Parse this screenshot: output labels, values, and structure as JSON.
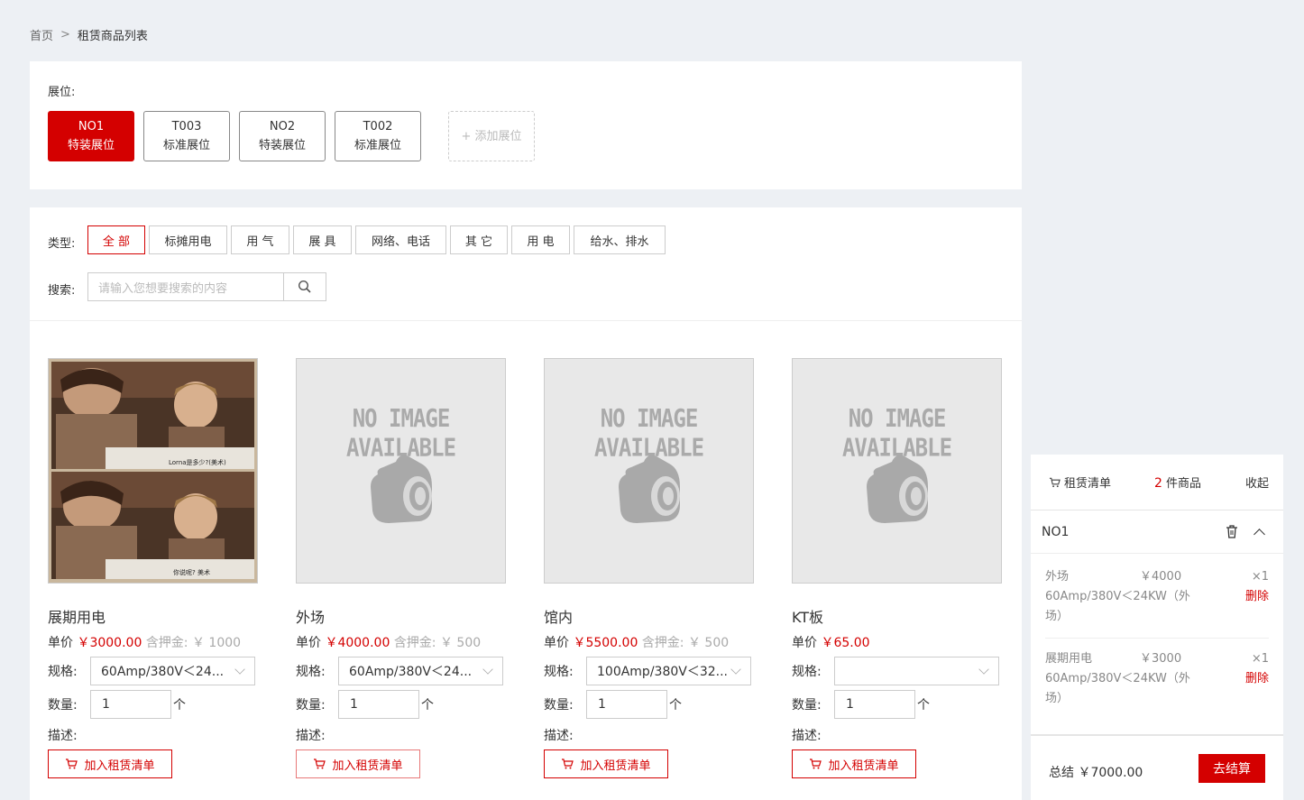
{
  "breadcrumb": {
    "home": "首页",
    "sep": ">",
    "current": "租赁商品列表"
  },
  "booths": {
    "label": "展位:",
    "items": [
      {
        "code": "NO1",
        "type": "特装展位"
      },
      {
        "code": "T003",
        "type": "标准展位"
      },
      {
        "code": "NO2",
        "type": "特装展位"
      },
      {
        "code": "T002",
        "type": "标准展位"
      }
    ],
    "add_label": "+ 添加展位"
  },
  "filters": {
    "type_label": "类型:",
    "types": [
      "全 部",
      "标摊用电",
      "用 气",
      "展 具",
      "网络、电话",
      "其 它",
      "用 电",
      "给水、排水"
    ],
    "search_label": "搜索:",
    "search_placeholder": "请输入您想要搜索的内容"
  },
  "products": [
    {
      "name": "展期用电",
      "price_label": "单价",
      "price": "￥3000.00",
      "deposit": "含押金: ￥ 1000",
      "spec_label": "规格:",
      "spec": "60Amp/380V＜24...",
      "qty_label": "数量:",
      "qty": "1",
      "unit": "个",
      "desc_label": "描述:",
      "add": "加入租赁清单"
    },
    {
      "name": "外场",
      "price_label": "单价",
      "price": "￥4000.00",
      "deposit": "含押金: ￥ 500",
      "spec_label": "规格:",
      "spec": "60Amp/380V＜24...",
      "qty_label": "数量:",
      "qty": "1",
      "unit": "个",
      "desc_label": "描述:",
      "add": "加入租赁清单"
    },
    {
      "name": "馆内",
      "price_label": "单价",
      "price": "￥5500.00",
      "deposit": "含押金: ￥ 500",
      "spec_label": "规格:",
      "spec": "100Amp/380V＜32...",
      "qty_label": "数量:",
      "qty": "1",
      "unit": "个",
      "desc_label": "描述:",
      "add": "加入租赁清单"
    },
    {
      "name": "KT板",
      "price_label": "单价",
      "price": "￥65.00",
      "deposit": "",
      "spec_label": "规格:",
      "spec": "",
      "qty_label": "数量:",
      "qty": "1",
      "unit": "个",
      "desc_label": "描述:",
      "add": "加入租赁清单"
    }
  ],
  "no_image_text": "NO IMAGE AVAILABLE",
  "subtitle_lines": [
    "Lorna是多少?(美术)",
    "你说呢? 美术"
  ],
  "cart": {
    "title": "租赁清单",
    "count": "2",
    "count_suffix": " 件商品",
    "fold": "收起",
    "booth": "NO1",
    "items": [
      {
        "name": "外场",
        "price": "￥4000",
        "qty": "×1",
        "spec": "60Amp/380V＜24KW（外场）",
        "delete": "删除"
      },
      {
        "name": "展期用电",
        "price": "￥3000",
        "qty": "×1",
        "spec": "60Amp/380V＜24KW（外场）",
        "delete": "删除"
      }
    ],
    "total": "总结 ￥7000.00",
    "checkout": "去结算"
  },
  "colors": {
    "accent": "#d40000",
    "background": "#edf0f4"
  }
}
